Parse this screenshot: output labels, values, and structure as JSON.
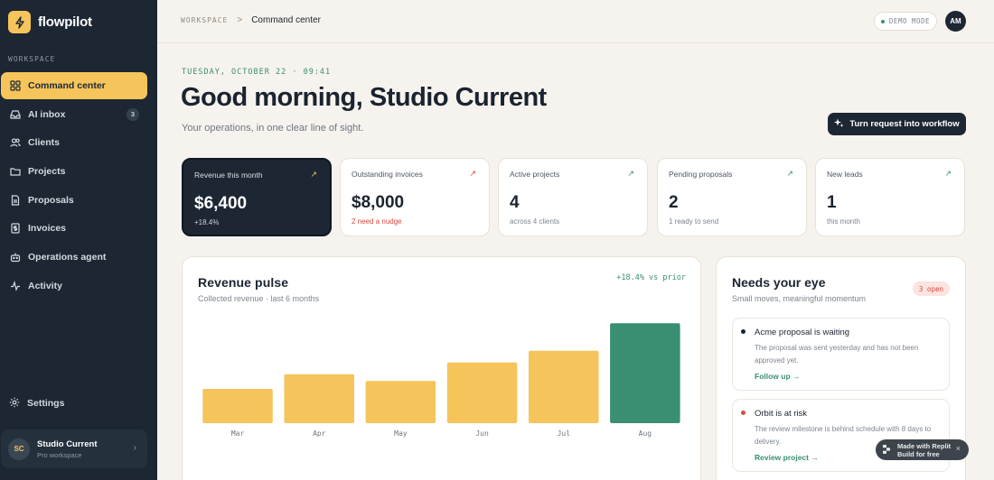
{
  "brand": {
    "name": "flowpilot"
  },
  "sidebar": {
    "section": "WORKSPACE",
    "items": [
      {
        "label": "Command center",
        "icon": "grid-icon",
        "active": true
      },
      {
        "label": "AI inbox",
        "icon": "inbox-icon",
        "badge": "3"
      },
      {
        "label": "Clients",
        "icon": "users-icon"
      },
      {
        "label": "Projects",
        "icon": "folder-icon"
      },
      {
        "label": "Proposals",
        "icon": "document-icon"
      },
      {
        "label": "Invoices",
        "icon": "invoice-icon"
      },
      {
        "label": "Operations agent",
        "icon": "bot-icon"
      },
      {
        "label": "Activity",
        "icon": "activity-icon"
      }
    ],
    "settings_label": "Settings",
    "account": {
      "initials": "SC",
      "name": "Studio Current",
      "plan": "Pro workspace"
    }
  },
  "topbar": {
    "breadcrumb_root": "WORKSPACE",
    "breadcrumb_sep": ">",
    "breadcrumb_current": "Command center",
    "demo_label": "DEMO MODE",
    "user_initials": "AM"
  },
  "header": {
    "dateline": "TUESDAY, OCTOBER 22 · 09:41",
    "greeting": "Good morning, Studio Current",
    "subtitle": "Your operations, in one clear line of sight.",
    "workflow_button": "Turn request into workflow"
  },
  "kpis": [
    {
      "label": "Revenue this month",
      "value": "$6,400",
      "note": "+18.4%",
      "arrow": "↗",
      "arrow_color": "#f5c45a"
    },
    {
      "label": "Outstanding invoices",
      "value": "$8,000",
      "note": "2 need a nudge",
      "arrow": "↗",
      "arrow_color": "#d8483f"
    },
    {
      "label": "Active projects",
      "value": "4",
      "note": "across 4 clients",
      "arrow": "↗",
      "arrow_color": "#3a8f73"
    },
    {
      "label": "Pending proposals",
      "value": "2",
      "note": "1 ready to send",
      "arrow": "↗",
      "arrow_color": "#3a8f73"
    },
    {
      "label": "New leads",
      "value": "1",
      "note": "this month",
      "arrow": "↗",
      "arrow_color": "#3a8f73"
    }
  ],
  "revenue": {
    "title": "Revenue pulse",
    "subtitle": "Collected revenue · last 6 months",
    "delta": "+18.4% vs prior"
  },
  "chart_data": {
    "type": "bar",
    "categories": [
      "Mar",
      "Apr",
      "May",
      "Jun",
      "Jul",
      "Aug"
    ],
    "values": [
      3.5,
      5.0,
      4.3,
      6.2,
      7.4,
      10.2
    ],
    "ylim": [
      0,
      10.5
    ],
    "highlight_index": 5,
    "bar_color": "#f5c45a",
    "highlight_color": "#3a8f73",
    "grid": false,
    "title": "",
    "xlabel": "",
    "ylabel": ""
  },
  "needs": {
    "title": "Needs your eye",
    "subtitle": "Small moves, meaningful momentum",
    "badge": "3 open",
    "alerts": [
      {
        "title": "Acme proposal is waiting",
        "body": "The proposal was sent yesterday and has not been approved yet.",
        "link": "Follow up →",
        "dot_color": "#1a2430"
      },
      {
        "title": "Orbit is at risk",
        "body": "The review milestone is behind schedule with 8 days to delivery.",
        "link": "Review project →",
        "dot_color": "#d8483f"
      }
    ]
  },
  "made_badge": {
    "line1": "Made with Replit",
    "line2": "Build for free",
    "close": "×"
  }
}
